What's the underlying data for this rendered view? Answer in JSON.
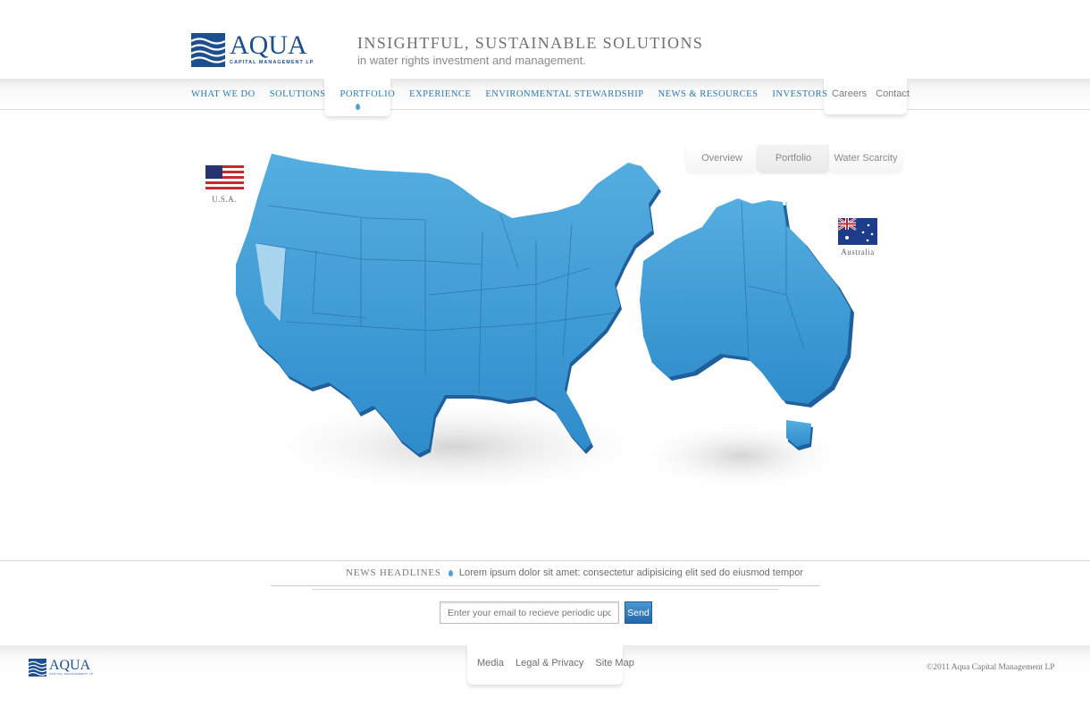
{
  "header": {
    "logo_word": "AQUA",
    "logo_sub": "CAPITAL MANAGEMENT LP",
    "tagline_main": "INSIGHTFUL, SUSTAINABLE SOLUTIONS",
    "tagline_sub": "in water rights investment and management."
  },
  "nav": {
    "items": [
      {
        "label": "WHAT WE DO"
      },
      {
        "label": "SOLUTIONS"
      },
      {
        "label": "PORTFOLIO"
      },
      {
        "label": "EXPERIENCE"
      },
      {
        "label": "ENVIRONMENTAL STEWARDSHIP"
      },
      {
        "label": "NEWS & RESOURCES"
      },
      {
        "label": "INVESTORS"
      }
    ],
    "active": "PORTFOLIO",
    "utility": [
      {
        "label": "Careers"
      },
      {
        "label": "Contact"
      }
    ]
  },
  "map_tabs": [
    {
      "label": "Overview"
    },
    {
      "label": "Portfolio"
    },
    {
      "label": "Water Scarcity"
    }
  ],
  "flags": {
    "usa": "U.S.A.",
    "australia": "Australia"
  },
  "news": {
    "label": "NEWS HEADLINES",
    "headline": "Lorem ipsum dolor sit amet: consectetur adipisicing elit sed do eiusmod tempor"
  },
  "signup": {
    "placeholder": "Enter your email to recieve periodic updates.",
    "button": "Send"
  },
  "footer": {
    "links": [
      {
        "label": "Media"
      },
      {
        "label": "Legal & Privacy"
      },
      {
        "label": "Site Map"
      }
    ],
    "copyright": "©2011 Aqua Capital Management LP",
    "logo_word": "AQUA",
    "logo_sub": "CAPITAL MANAGEMENT LP"
  },
  "colors": {
    "brand": "#1d4f8f",
    "link": "#2b78b3",
    "map_fill": "#3f9bd3",
    "map_edge": "#1f5f9c",
    "highlight": "#a8d4ee"
  }
}
